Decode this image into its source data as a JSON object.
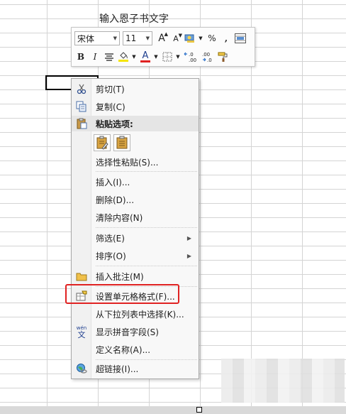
{
  "sheet": {
    "cell_text": "输入恩子书文字"
  },
  "mini_toolbar": {
    "font_name": "宋体",
    "font_size": "11",
    "grow_font": "A",
    "shrink_font": "A",
    "percent": "%",
    "comma": ",",
    "bold": "B",
    "italic": "I",
    "font_color_letter": "A",
    "fill_color": "#f5e500",
    "font_color": "#e02222",
    "dec_increase": "←.0\n.00",
    "dec_decrease": ".00\n→.0"
  },
  "context_menu": {
    "items": [
      {
        "label": "剪切(T)",
        "icon": "scissors-icon"
      },
      {
        "label": "复制(C)",
        "icon": "copy-icon"
      },
      {
        "label": "粘贴选项:",
        "icon": "clipboard-icon"
      },
      {
        "label": "选择性粘贴(S)...",
        "icon": ""
      },
      {
        "label": "插入(I)...",
        "icon": ""
      },
      {
        "label": "删除(D)...",
        "icon": ""
      },
      {
        "label": "清除内容(N)",
        "icon": ""
      },
      {
        "label": "筛选(E)",
        "icon": "",
        "submenu": "▶"
      },
      {
        "label": "排序(O)",
        "icon": "",
        "submenu": "▶"
      },
      {
        "label": "插入批注(M)",
        "icon": "comment-folder-icon"
      },
      {
        "label": "设置单元格格式(F)...",
        "icon": "format-cells-icon"
      },
      {
        "label": "从下拉列表中选择(K)...",
        "icon": ""
      },
      {
        "label": "显示拼音字段(S)",
        "icon": "phonetic-wen-icon"
      },
      {
        "label": "定义名称(A)...",
        "icon": ""
      },
      {
        "label": "超链接(I)...",
        "icon": "hyperlink-globe-icon"
      }
    ],
    "phonetic_icon_text": "wén",
    "phonetic_icon_char": "文"
  },
  "colors": {
    "highlight_border": "#e02222",
    "grid_line": "#d4d4d4",
    "menu_bg": "#f8f8f8"
  }
}
